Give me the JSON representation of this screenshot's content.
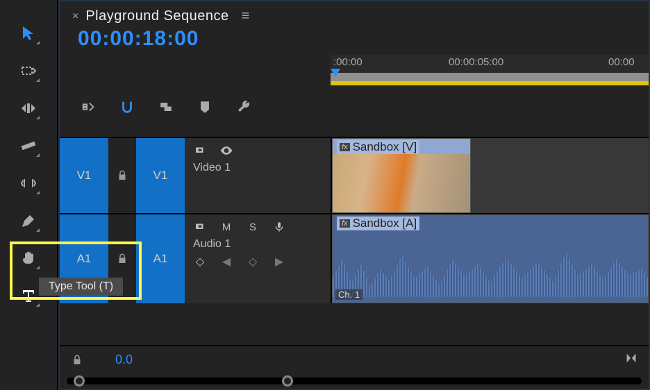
{
  "sequence": {
    "title": "Playground Sequence",
    "timecode": "00:00:18:00"
  },
  "tools": {
    "selection": {
      "name": "Selection Tool"
    },
    "trackfwd": {
      "name": "Track Select Forward Tool"
    },
    "ripple": {
      "name": "Ripple Edit Tool"
    },
    "razor": {
      "name": "Razor Tool"
    },
    "slip": {
      "name": "Slip Tool"
    },
    "pen": {
      "name": "Pen Tool"
    },
    "hand": {
      "name": "Hand Tool"
    },
    "type": {
      "name": "Type Tool",
      "tooltip": "Type Tool (T)"
    }
  },
  "ruler": {
    "ticks": [
      ":00:00",
      "00:00:05:00",
      "00:00"
    ]
  },
  "tracks": {
    "video": {
      "src": "V1",
      "tgt": "V1",
      "label": "Video 1",
      "clip": {
        "name": "Sandbox [V]"
      }
    },
    "audio": {
      "src": "A1",
      "tgt": "A1",
      "label": "Audio 1",
      "mute": "M",
      "solo": "S",
      "keyframe": "◇",
      "clip": {
        "name": "Sandbox [A]",
        "channel": "Ch. 1"
      }
    }
  },
  "footer": {
    "zoom": "0.0"
  }
}
